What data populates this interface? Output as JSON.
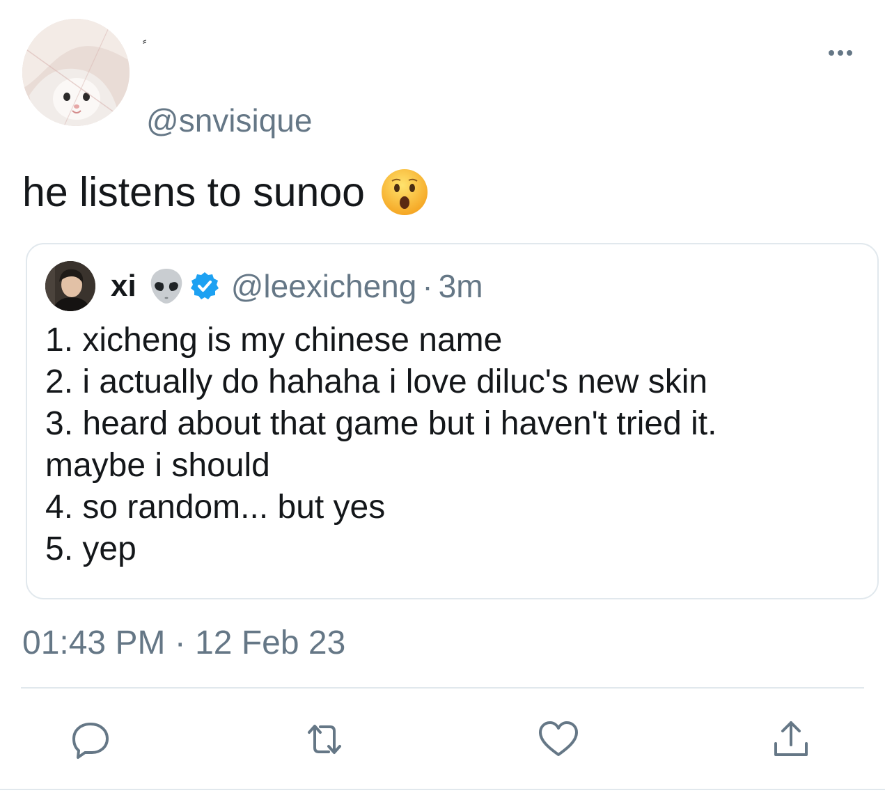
{
  "tweet": {
    "display_name": "⸗",
    "handle": "@snvisique",
    "text": "he listens to sunoo",
    "emoji": "astonished-face-icon",
    "timestamp": "01:43 PM · 12 Feb 23"
  },
  "quoted_tweet": {
    "name": "xi",
    "name_emoji": "alien-icon",
    "verified": true,
    "handle": "@leexicheng",
    "separator": "·",
    "time": "3m",
    "lines": [
      "1. xicheng is my chinese name",
      "2. i actually do hahaha i love diluc's new skin",
      "3. heard about that game but i haven't tried it.",
      "maybe i should",
      "4. so random... but yes",
      "5. yep"
    ]
  },
  "actions": [
    "reply-icon",
    "retweet-icon",
    "like-icon",
    "share-icon"
  ],
  "colors": {
    "text": "#14171a",
    "secondary": "#657786",
    "border": "#e1e8ed",
    "verified": "#1da1f2"
  }
}
